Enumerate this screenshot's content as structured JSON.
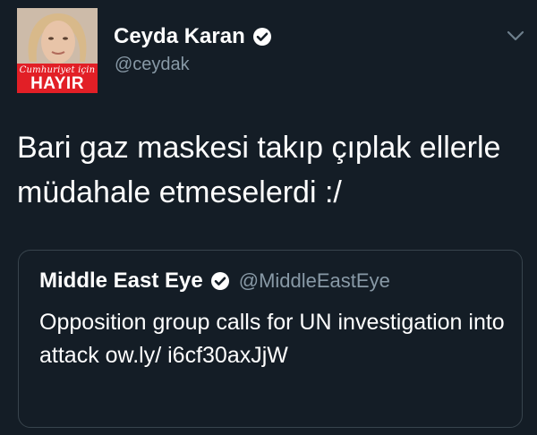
{
  "tweet": {
    "author": {
      "name": "Ceyda Karan",
      "handle": "@ceydak",
      "verified": true,
      "avatar_icon": "profile-photo",
      "avatar_caption_small": "Cumhuriyet için",
      "avatar_caption_big": "HAYIR"
    },
    "menu_icon": "chevron-down-icon",
    "text": "Bari gaz maskesi takıp çıplak ellerle müdahale etmeselerdi :/",
    "quoted_tweet": {
      "author_name": "Middle East Eye",
      "author_handle": "@MiddleEastEye",
      "verified": true,
      "text": "Opposition group calls for UN investigation into attack ow.ly/ i6cf30axJjW"
    }
  },
  "colors": {
    "background": "#141d26",
    "text_primary": "#ffffff",
    "text_secondary": "#8899a6",
    "border": "#38444d",
    "avatar_banner": "#e21f26"
  }
}
